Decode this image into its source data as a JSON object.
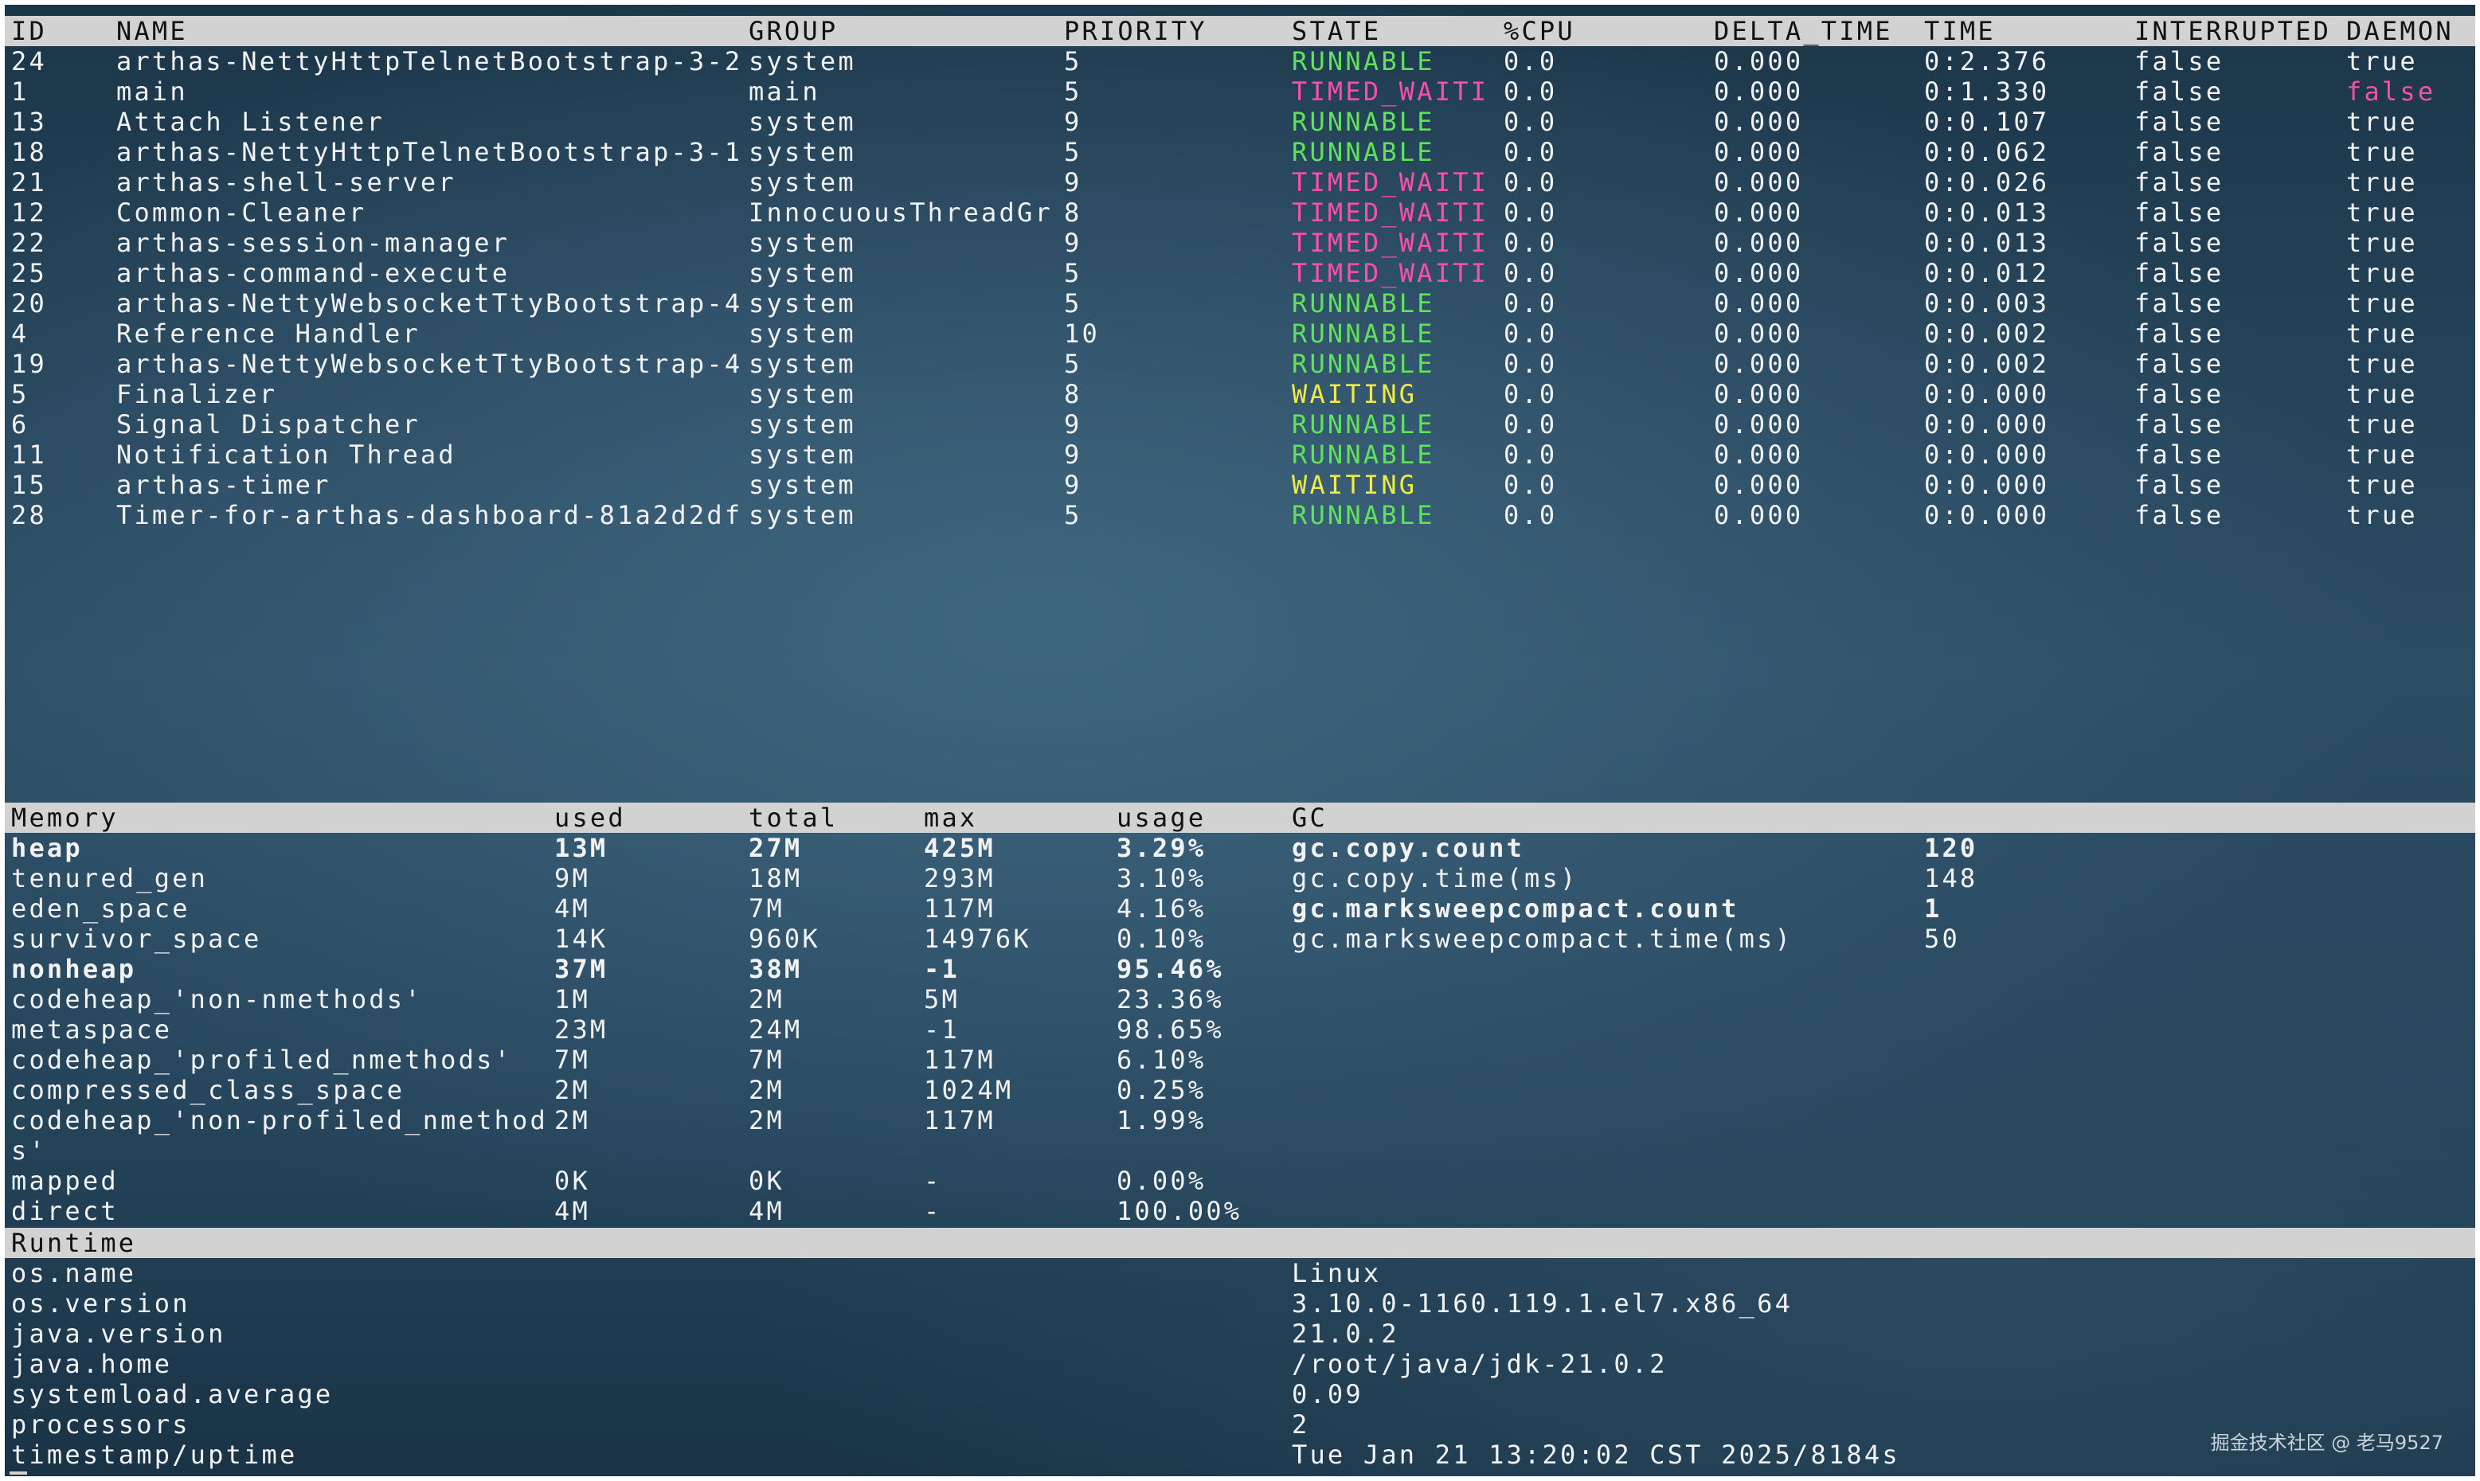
{
  "threads": {
    "columns": [
      "ID",
      "NAME",
      "GROUP",
      "PRIORITY",
      "STATE",
      "%CPU",
      "DELTA_TIME",
      "TIME",
      "INTERRUPTED",
      "DAEMON"
    ],
    "rows": [
      [
        "24",
        "arthas-NettyHttpTelnetBootstrap-3-2",
        "system",
        "5",
        "RUNNABLE",
        "0.0",
        "0.000",
        "0:2.376",
        "false",
        "true"
      ],
      [
        "1",
        "main",
        "main",
        "5",
        "TIMED_WAITI",
        "0.0",
        "0.000",
        "0:1.330",
        "false",
        "false"
      ],
      [
        "13",
        "Attach Listener",
        "system",
        "9",
        "RUNNABLE",
        "0.0",
        "0.000",
        "0:0.107",
        "false",
        "true"
      ],
      [
        "18",
        "arthas-NettyHttpTelnetBootstrap-3-1",
        "system",
        "5",
        "RUNNABLE",
        "0.0",
        "0.000",
        "0:0.062",
        "false",
        "true"
      ],
      [
        "21",
        "arthas-shell-server",
        "system",
        "9",
        "TIMED_WAITI",
        "0.0",
        "0.000",
        "0:0.026",
        "false",
        "true"
      ],
      [
        "12",
        "Common-Cleaner",
        "InnocuousThreadGr",
        "8",
        "TIMED_WAITI",
        "0.0",
        "0.000",
        "0:0.013",
        "false",
        "true"
      ],
      [
        "22",
        "arthas-session-manager",
        "system",
        "9",
        "TIMED_WAITI",
        "0.0",
        "0.000",
        "0:0.013",
        "false",
        "true"
      ],
      [
        "25",
        "arthas-command-execute",
        "system",
        "5",
        "TIMED_WAITI",
        "0.0",
        "0.000",
        "0:0.012",
        "false",
        "true"
      ],
      [
        "20",
        "arthas-NettyWebsocketTtyBootstrap-4",
        "system",
        "5",
        "RUNNABLE",
        "0.0",
        "0.000",
        "0:0.003",
        "false",
        "true"
      ],
      [
        "4",
        "Reference Handler",
        "system",
        "10",
        "RUNNABLE",
        "0.0",
        "0.000",
        "0:0.002",
        "false",
        "true"
      ],
      [
        "19",
        "arthas-NettyWebsocketTtyBootstrap-4",
        "system",
        "5",
        "RUNNABLE",
        "0.0",
        "0.000",
        "0:0.002",
        "false",
        "true"
      ],
      [
        "5",
        "Finalizer",
        "system",
        "8",
        "WAITING",
        "0.0",
        "0.000",
        "0:0.000",
        "false",
        "true"
      ],
      [
        "6",
        "Signal Dispatcher",
        "system",
        "9",
        "RUNNABLE",
        "0.0",
        "0.000",
        "0:0.000",
        "false",
        "true"
      ],
      [
        "11",
        "Notification Thread",
        "system",
        "9",
        "RUNNABLE",
        "0.0",
        "0.000",
        "0:0.000",
        "false",
        "true"
      ],
      [
        "15",
        "arthas-timer",
        "system",
        "9",
        "WAITING",
        "0.0",
        "0.000",
        "0:0.000",
        "false",
        "true"
      ],
      [
        "28",
        "Timer-for-arthas-dashboard-81a2d2df",
        "system",
        "5",
        "RUNNABLE",
        "0.0",
        "0.000",
        "0:0.000",
        "false",
        "true"
      ]
    ]
  },
  "memory": {
    "columns": [
      "Memory",
      "used",
      "total",
      "max",
      "usage"
    ],
    "rows": [
      [
        "heap",
        "13M",
        "27M",
        "425M",
        "3.29%"
      ],
      [
        "tenured_gen",
        "9M",
        "18M",
        "293M",
        "3.10%"
      ],
      [
        "eden_space",
        "4M",
        "7M",
        "117M",
        "4.16%"
      ],
      [
        "survivor_space",
        "14K",
        "960K",
        "14976K",
        "0.10%"
      ],
      [
        "nonheap",
        "37M",
        "38M",
        "-1",
        "95.46%"
      ],
      [
        "codeheap_'non-nmethods'",
        "1M",
        "2M",
        "5M",
        "23.36%"
      ],
      [
        "metaspace",
        "23M",
        "24M",
        "-1",
        "98.65%"
      ],
      [
        "codeheap_'profiled_nmethods'",
        "7M",
        "7M",
        "117M",
        "6.10%"
      ],
      [
        "compressed_class_space",
        "2M",
        "2M",
        "1024M",
        "0.25%"
      ],
      [
        "codeheap_'non-profiled_nmethod",
        "2M",
        "2M",
        "117M",
        "1.99%"
      ],
      [
        "s'",
        "",
        "",
        "",
        ""
      ],
      [
        "mapped",
        "0K",
        "0K",
        "-",
        "0.00%"
      ],
      [
        "direct",
        "4M",
        "4M",
        "-",
        "100.00%"
      ]
    ]
  },
  "gc": {
    "header": "GC",
    "rows": [
      [
        "gc.copy.count",
        "120"
      ],
      [
        "gc.copy.time(ms)",
        "148"
      ],
      [
        "gc.marksweepcompact.count",
        "1"
      ],
      [
        "gc.marksweepcompact.time(ms)",
        "50"
      ]
    ]
  },
  "runtime": {
    "header": "Runtime",
    "rows": [
      [
        "os.name",
        "Linux"
      ],
      [
        "os.version",
        "3.10.0-1160.119.1.el7.x86_64"
      ],
      [
        "java.version",
        "21.0.2"
      ],
      [
        "java.home",
        "/root/java/jdk-21.0.2"
      ],
      [
        "systemload.average",
        "0.09"
      ],
      [
        "processors",
        "2"
      ],
      [
        "timestamp/uptime",
        "Tue Jan 21 13:20:02 CST 2025/8184s"
      ]
    ]
  },
  "watermark": "掘金技术社区 @ 老马9527",
  "colors": {
    "runnable": "#5fe35a",
    "timed_waiting": "#ff4fa6",
    "waiting": "#f1ea45",
    "header_bar": "#d2d2d2"
  }
}
